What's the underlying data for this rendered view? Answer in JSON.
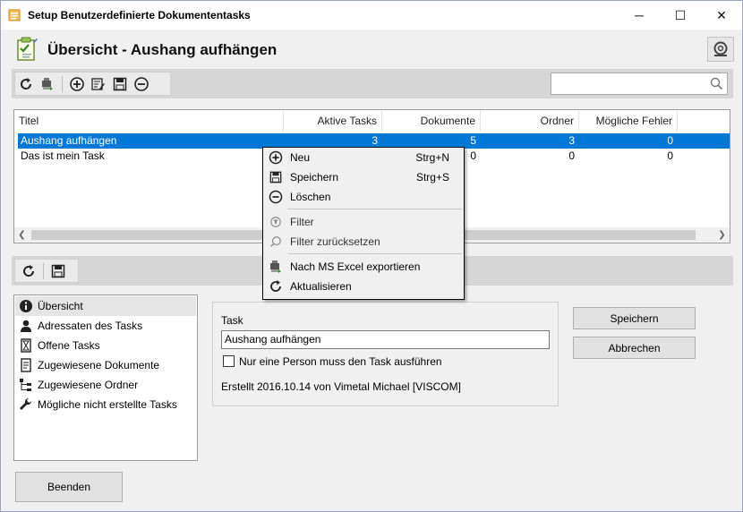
{
  "window": {
    "title": "Setup Benutzerdefinierte Dokumententasks",
    "minimize": "─",
    "maximize": "☐",
    "close": "✕"
  },
  "header": {
    "title": "Übersicht - Aushang aufhängen"
  },
  "search": {
    "placeholder": "",
    "value": ""
  },
  "grid": {
    "columns": [
      "Titel",
      "Aktive Tasks",
      "Dokumente",
      "Ordner",
      "Mögliche Fehler"
    ],
    "rows": [
      {
        "titel": "Aushang aufhängen",
        "aktive_tasks": "3",
        "dokumente": "5",
        "ordner": "3",
        "fehler": "0",
        "selected": true
      },
      {
        "titel": "Das ist mein Task",
        "aktive_tasks": "",
        "dokumente": "0",
        "ordner": "0",
        "fehler": "0",
        "selected": false
      }
    ]
  },
  "context_menu": {
    "items": [
      {
        "label": "Neu",
        "shortcut": "Strg+N",
        "icon": "plus-circle-icon"
      },
      {
        "label": "Speichern",
        "shortcut": "Strg+S",
        "icon": "save-icon"
      },
      {
        "label": "Löschen",
        "shortcut": "",
        "icon": "minus-circle-icon"
      },
      {
        "label": "Filter",
        "shortcut": "",
        "icon": "filter-icon"
      },
      {
        "label": "Filter zurücksetzen",
        "shortcut": "",
        "icon": "search-icon"
      },
      {
        "label": "Nach MS Excel exportieren",
        "shortcut": "",
        "icon": "excel-export-icon"
      },
      {
        "label": "Aktualisieren",
        "shortcut": "",
        "icon": "refresh-icon"
      }
    ]
  },
  "nav": {
    "items": [
      {
        "label": "Übersicht",
        "icon": "info-icon",
        "active": true
      },
      {
        "label": "Adressaten des Tasks",
        "icon": "person-icon"
      },
      {
        "label": "Offene Tasks",
        "icon": "hourglass-icon"
      },
      {
        "label": "Zugewiesene Dokumente",
        "icon": "document-icon"
      },
      {
        "label": "Zugewiesene Ordner",
        "icon": "folder-tree-icon"
      },
      {
        "label": "Mögliche nicht erstellte Tasks",
        "icon": "wrench-icon"
      }
    ]
  },
  "detail": {
    "task_label": "Task",
    "task_value": "Aushang aufhängen",
    "checkbox_label": "Nur eine Person muss den Task ausführen",
    "checkbox_checked": false,
    "created": "Erstellt 2016.10.14 von Vimetal Michael [VISCOM]"
  },
  "buttons": {
    "save": "Speichern",
    "cancel": "Abbrechen",
    "close": "Beenden"
  },
  "colors": {
    "selection": "#0078d7",
    "toolbar_strip": "#d6d6d6",
    "window_bg": "#f0f0f0"
  }
}
